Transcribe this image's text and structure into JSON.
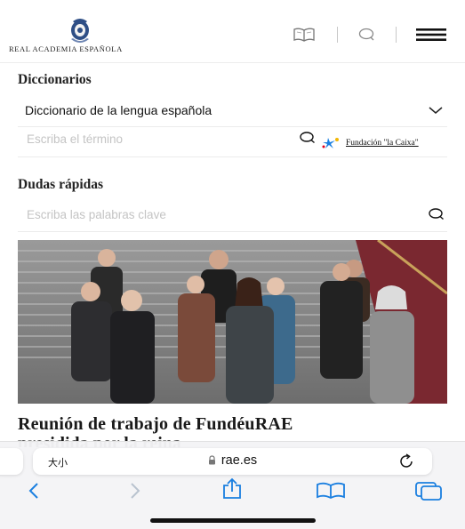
{
  "header": {
    "logo_text": "REAL ACADEMIA ESPAÑOLA",
    "icons": [
      "book-icon",
      "search-icon",
      "menu-icon"
    ]
  },
  "dictionaries": {
    "title": "Diccionarios",
    "selected": "Diccionario de la lengua española",
    "placeholder": "Escriba el término",
    "sponsor": "Fundación \"la Caixa\""
  },
  "quick_doubts": {
    "title": "Dudas rápidas",
    "placeholder": "Escriba las palabras clave"
  },
  "news": {
    "headline": "Reunión de trabajo de FundéuRAE",
    "headline_cont": "presidida por la reina"
  },
  "browser": {
    "text_size": "大小",
    "url": "rae.es"
  },
  "colors": {
    "accent_blue": "#1a7fe0",
    "text_dark": "#1a1a1a"
  }
}
